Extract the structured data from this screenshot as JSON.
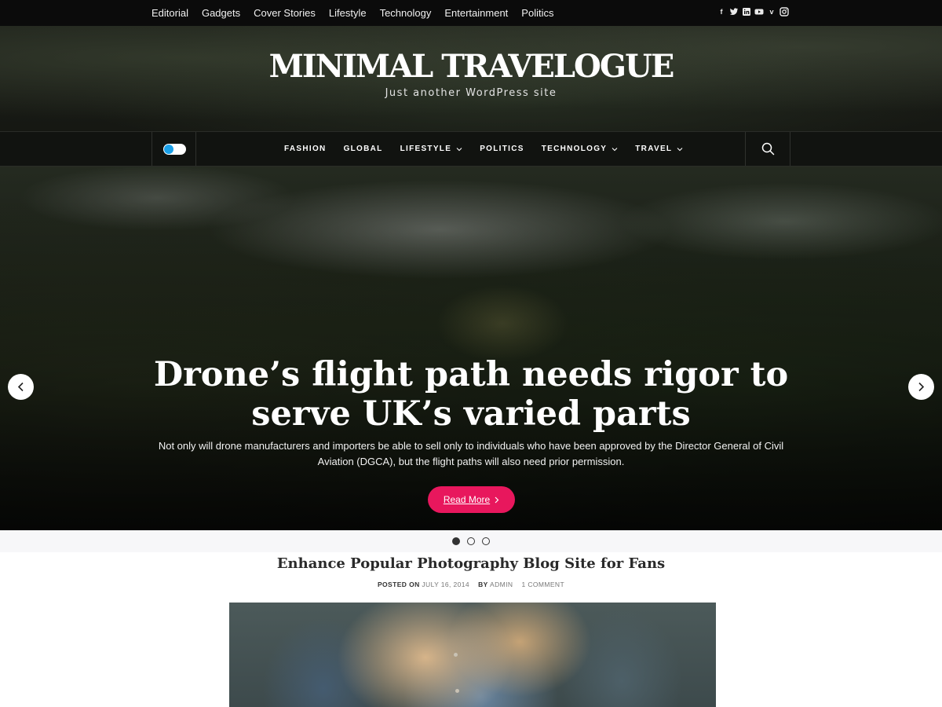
{
  "topbar": {
    "links": [
      "Editorial",
      "Gadgets",
      "Cover Stories",
      "Lifestyle",
      "Technology",
      "Entertainment",
      "Politics"
    ],
    "social_icons": [
      "facebook-icon",
      "twitter-icon",
      "linkedin-icon",
      "youtube-icon",
      "vimeo-icon",
      "instagram-icon"
    ]
  },
  "header": {
    "title": "MINIMAL TRAVELOGUE",
    "tagline": "Just another WordPress site"
  },
  "mainnav": {
    "items": [
      {
        "label": "FASHION",
        "dropdown": false
      },
      {
        "label": "GLOBAL",
        "dropdown": false
      },
      {
        "label": "LIFESTYLE",
        "dropdown": true
      },
      {
        "label": "POLITICS",
        "dropdown": false
      },
      {
        "label": "TECHNOLOGY",
        "dropdown": true
      },
      {
        "label": "TRAVEL",
        "dropdown": true
      }
    ],
    "toggle_color": "#1aa0e8"
  },
  "hero": {
    "title_line1": "Drone’s flight path needs rigor to",
    "title_line2": "serve UK’s varied parts",
    "excerpt": "Not only will drone manufacturers and importers be able to sell only to individuals who have been approved by the Director General of Civil Aviation (DGCA), but the flight paths will also need prior permission.",
    "read_more": "Read More",
    "accent_color": "#e8175d",
    "slides_total": 3,
    "active_slide": 1
  },
  "post": {
    "title": "Enhance Popular Photography Blog Site for Fans",
    "posted_on_label": "POSTED ON",
    "date": "JULY 16, 2014",
    "by_label": "BY",
    "author": "ADMIN",
    "comments": "1 COMMENT"
  }
}
